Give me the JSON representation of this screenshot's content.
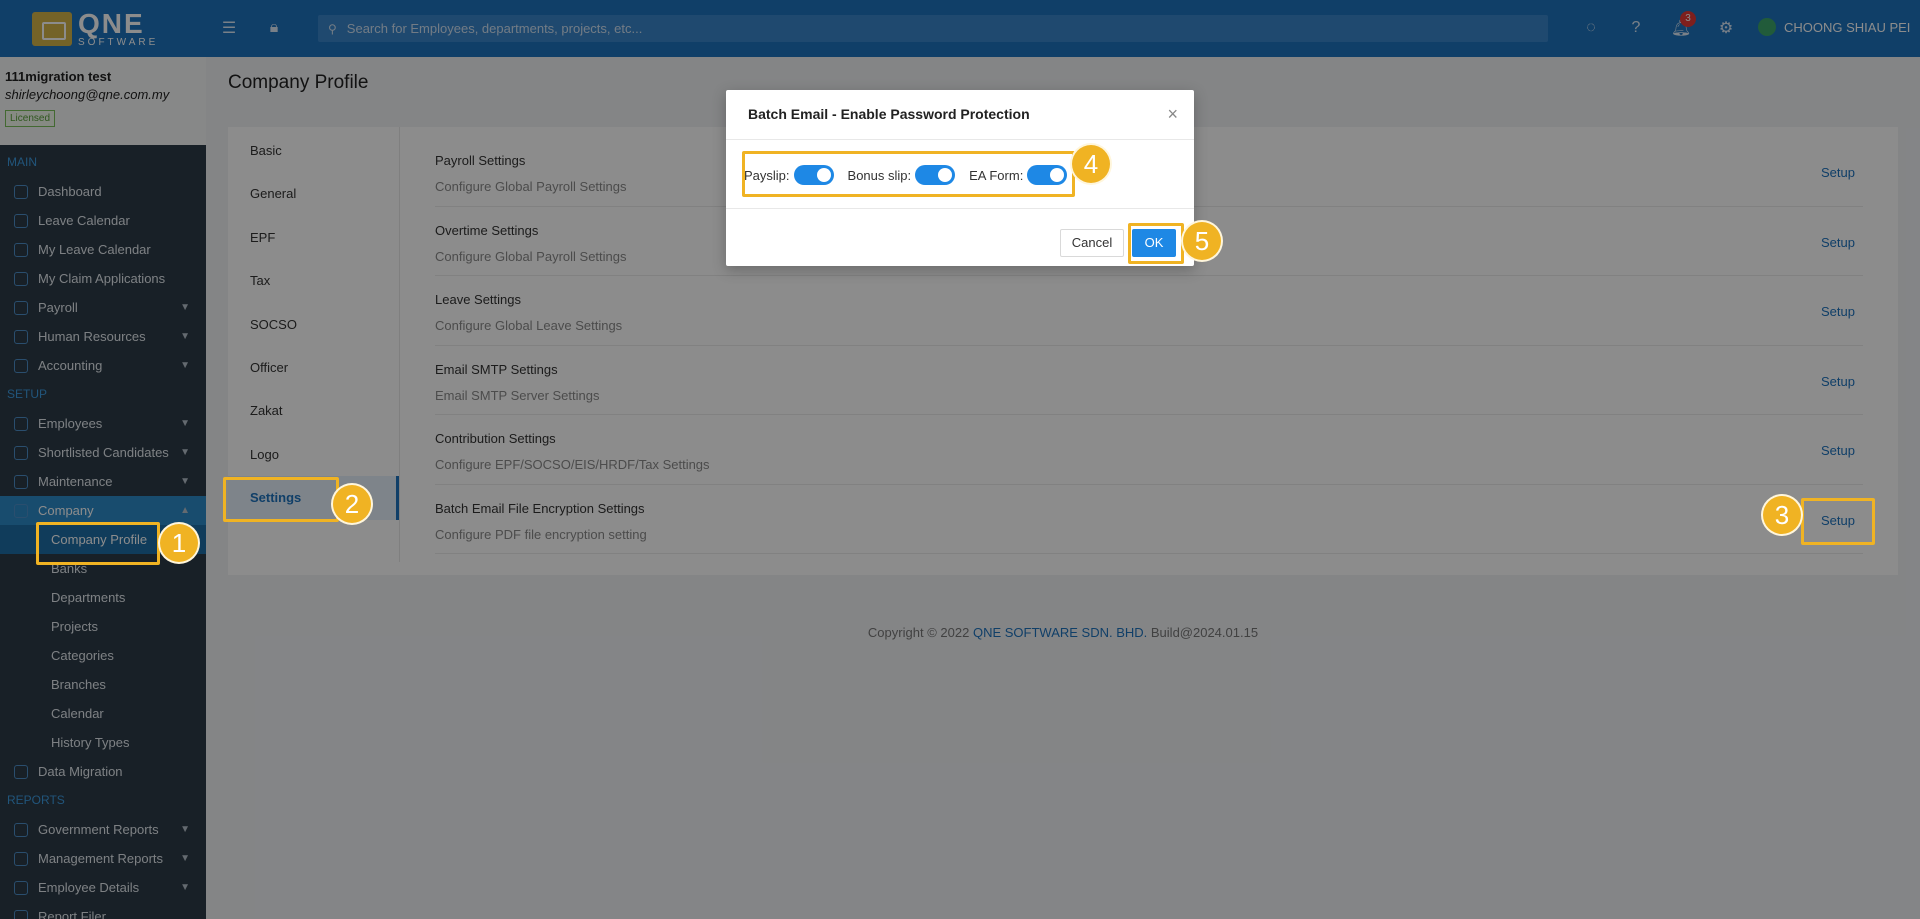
{
  "topbar": {
    "logo_main": "QNE",
    "logo_sub": "SOFTWARE",
    "search_placeholder": "Search for Employees, departments, projects, etc...",
    "notification_count": "3",
    "user_name": "CHOONG SHIAU PEI"
  },
  "account": {
    "name": "111migration test",
    "email": "shirleychoong@qne.com.my",
    "license": "Licensed"
  },
  "sidebar": {
    "main_label": "MAIN",
    "main_items": [
      "Dashboard",
      "Leave Calendar",
      "My Leave Calendar",
      "My Claim Applications",
      "Payroll",
      "Human Resources",
      "Accounting"
    ],
    "setup_label": "SETUP",
    "setup_items": [
      "Employees",
      "Shortlisted Candidates",
      "Maintenance",
      "Company"
    ],
    "company_sub": [
      "Company Profile",
      "Banks",
      "Departments",
      "Projects",
      "Categories",
      "Branches",
      "Calendar",
      "History Types"
    ],
    "data_migration": "Data Migration",
    "reports_label": "REPORTS",
    "report_items": [
      "Government Reports",
      "Management Reports",
      "Employee Details",
      "Report Filer"
    ]
  },
  "page": {
    "title": "Company Profile",
    "tabs": [
      "Basic",
      "General",
      "EPF",
      "Tax",
      "SOCSO",
      "Officer",
      "Zakat",
      "Logo",
      "Settings"
    ],
    "settings": [
      {
        "title": "Payroll Settings",
        "desc": "Configure Global Payroll Settings",
        "link": "Setup"
      },
      {
        "title": "Overtime Settings",
        "desc": "Configure Global Payroll Settings",
        "link": "Setup"
      },
      {
        "title": "Leave Settings",
        "desc": "Configure Global Leave Settings",
        "link": "Setup"
      },
      {
        "title": "Email SMTP Settings",
        "desc": "Email SMTP Server Settings",
        "link": "Setup"
      },
      {
        "title": "Contribution Settings",
        "desc": "Configure EPF/SOCSO/EIS/HRDF/Tax Settings",
        "link": "Setup"
      },
      {
        "title": "Batch Email File Encryption Settings",
        "desc": "Configure PDF file encryption setting",
        "link": "Setup"
      }
    ]
  },
  "footer": {
    "prefix": "Copyright",
    "copyright_symbol": "©",
    "year": "2022",
    "brand": "QNE SOFTWARE SDN. BHD.",
    "build": "Build@2024.01.15"
  },
  "modal": {
    "title": "Batch Email - Enable Password Protection",
    "close": "×",
    "toggles": [
      {
        "label": "Payslip:",
        "on": true
      },
      {
        "label": "Bonus slip:",
        "on": true
      },
      {
        "label": "EA Form:",
        "on": true
      }
    ],
    "cancel": "Cancel",
    "ok": "OK"
  },
  "annotations": [
    "1",
    "2",
    "3",
    "4",
    "5"
  ],
  "colors": {
    "topbar": "#1e73be",
    "sidebar": "#2c3b48",
    "accent": "#1e88e5",
    "highlight": "#f0b323"
  }
}
